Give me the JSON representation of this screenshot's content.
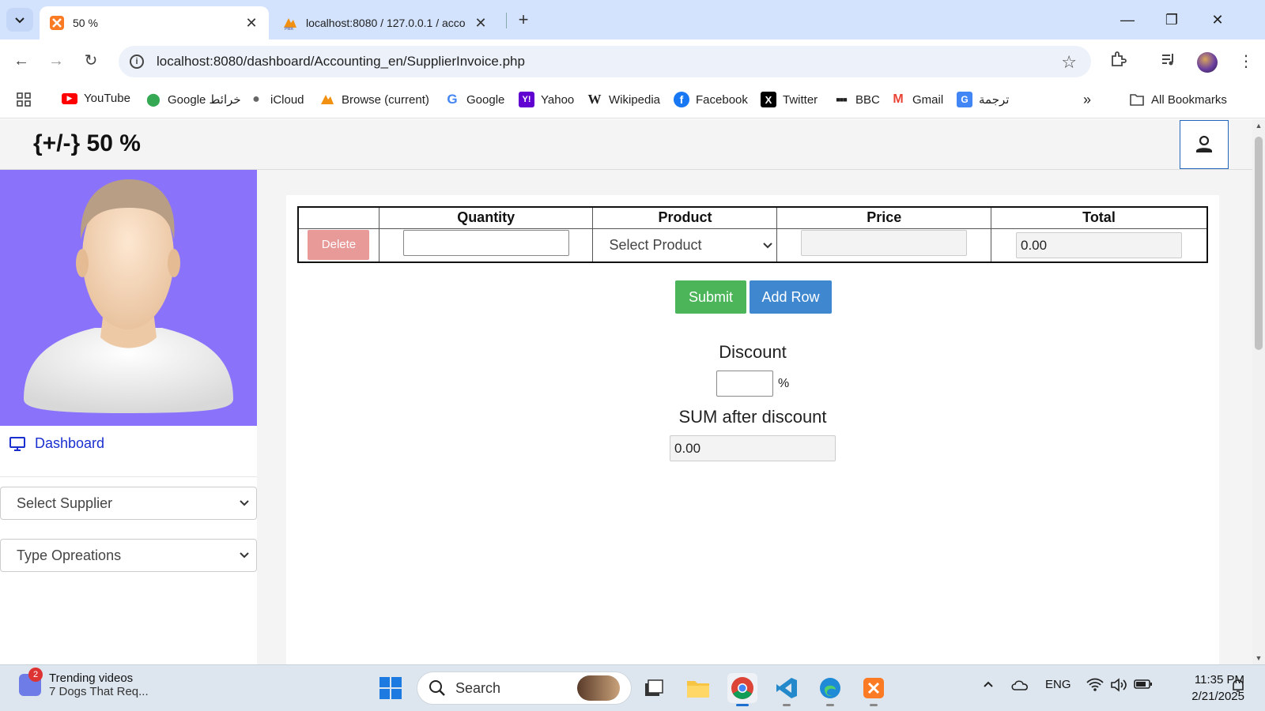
{
  "browser": {
    "tabs": [
      {
        "title": "50 %",
        "active": true
      },
      {
        "title": "localhost:8080 / 127.0.0.1 / acco",
        "active": false
      }
    ],
    "url": "localhost:8080/dashboard/Accounting_en/SupplierInvoice.php",
    "bookmarks": [
      {
        "label": "YouTube",
        "icon": "youtube-icon"
      },
      {
        "label": "Google خرائط",
        "icon": "maps-icon"
      },
      {
        "label": "iCloud",
        "icon": "apple-icon"
      },
      {
        "label": "Browse (current)",
        "icon": "phpmyadmin-icon"
      },
      {
        "label": "Google",
        "icon": "google-icon"
      },
      {
        "label": "Yahoo",
        "icon": "yahoo-icon"
      },
      {
        "label": "Wikipedia",
        "icon": "wikipedia-icon"
      },
      {
        "label": "Facebook",
        "icon": "facebook-icon"
      },
      {
        "label": "Twitter",
        "icon": "x-icon"
      },
      {
        "label": "BBC",
        "icon": "bbc-icon"
      },
      {
        "label": "Gmail",
        "icon": "gmail-icon"
      },
      {
        "label": "ترجمة",
        "icon": "translate-icon"
      }
    ],
    "all_bookmarks": "All Bookmarks"
  },
  "app": {
    "brand": "{+/-} 50 %",
    "sidebar": {
      "dashboard_label": "Dashboard",
      "supplier_select": "Select Supplier",
      "operations_select": "Type Opreations"
    },
    "invoice_table": {
      "headers": [
        "",
        "Quantity",
        "Product",
        "Price",
        "Total"
      ],
      "rows": [
        {
          "delete_label": "Delete",
          "quantity": "",
          "product": "Select Product",
          "price": "",
          "total": "0.00"
        }
      ]
    },
    "buttons": {
      "submit": "Submit",
      "add_row": "Add Row"
    },
    "discount": {
      "label": "Discount",
      "value": "",
      "unit": "%"
    },
    "sum_after_discount": {
      "label": "SUM after discount",
      "value": "0.00"
    }
  },
  "taskbar": {
    "widget": {
      "badge": "2",
      "title": "Trending videos",
      "subtitle": "7 Dogs That Req..."
    },
    "search_placeholder": "Search",
    "language": "ENG",
    "time": "11:35 PM",
    "date": "2/21/2025"
  },
  "colors": {
    "avatar_bg": "#8b72fb",
    "submit": "#4cb55a",
    "add_row": "#3f88d0",
    "delete": "#e89a99",
    "dashboard_link": "#1a2fd0"
  }
}
